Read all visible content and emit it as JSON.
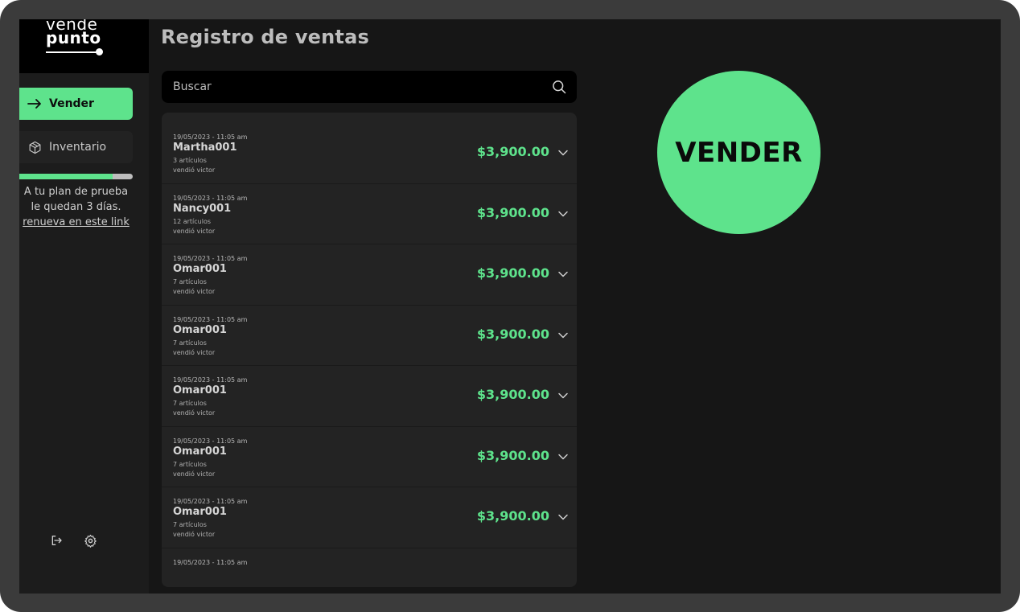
{
  "brand": {
    "top": "vende",
    "bottom": "punto"
  },
  "title": "Registro de ventas",
  "nav": {
    "vender": "Vender",
    "inventario": "Inventario"
  },
  "plan": {
    "progress": 0.82,
    "line1": "A tu plan de prueba",
    "line2": "le quedan 3 días.",
    "link": "renueva en este link"
  },
  "icons": {
    "logout": "logout-icon",
    "settings": "gear-icon",
    "search": "search-icon",
    "chevron": "chevron-down-icon"
  },
  "colors": {
    "accent": "#5ee38c",
    "panel": "#232323",
    "background": "#161616"
  },
  "search": {
    "placeholder": "Buscar"
  },
  "sales": [
    {
      "date": "19/05/2023 - 11:05 am",
      "name": "Martha001",
      "items": "3 artículos",
      "seller": "vendió victor",
      "amount": "$3,900.00"
    },
    {
      "date": "19/05/2023 - 11:05 am",
      "name": "Nancy001",
      "items": "12 artículos",
      "seller": "vendió victor",
      "amount": "$3,900.00"
    },
    {
      "date": "19/05/2023 - 11:05 am",
      "name": "Omar001",
      "items": "7 artículos",
      "seller": "vendió victor",
      "amount": "$3,900.00"
    },
    {
      "date": "19/05/2023 - 11:05 am",
      "name": "Omar001",
      "items": "7 artículos",
      "seller": "vendió victor",
      "amount": "$3,900.00"
    },
    {
      "date": "19/05/2023 - 11:05 am",
      "name": "Omar001",
      "items": "7 artículos",
      "seller": "vendió victor",
      "amount": "$3,900.00"
    },
    {
      "date": "19/05/2023 - 11:05 am",
      "name": "Omar001",
      "items": "7 artículos",
      "seller": "vendió victor",
      "amount": "$3,900.00"
    },
    {
      "date": "19/05/2023 - 11:05 am",
      "name": "Omar001",
      "items": "7 artículos",
      "seller": "vendió victor",
      "amount": "$3,900.00"
    },
    {
      "date": "19/05/2023 - 11:05 am",
      "name": "",
      "items": "",
      "seller": "",
      "amount": ""
    }
  ],
  "cta": "VENDER"
}
